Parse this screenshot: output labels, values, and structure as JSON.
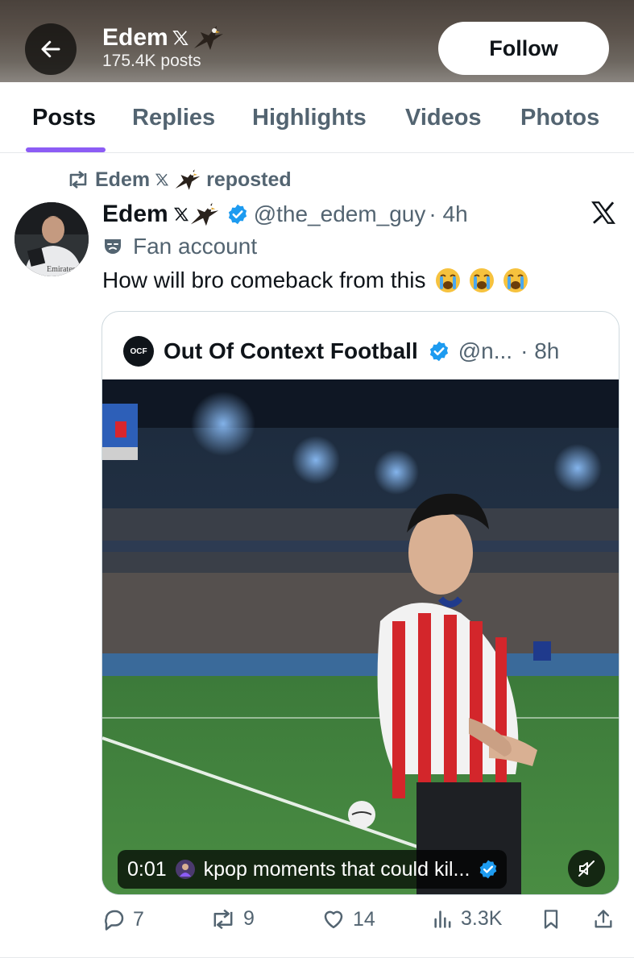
{
  "header": {
    "name": "Edem",
    "posts_count": "175.4K posts",
    "follow_label": "Follow"
  },
  "tabs": [
    {
      "label": "Posts",
      "active": true
    },
    {
      "label": "Replies",
      "active": false
    },
    {
      "label": "Highlights",
      "active": false
    },
    {
      "label": "Videos",
      "active": false
    },
    {
      "label": "Photos",
      "active": false
    }
  ],
  "post": {
    "repost_by": "Edem",
    "repost_suffix": "reposted",
    "author_name": "Edem",
    "author_handle": "@the_edem_guy",
    "time": "· 4h",
    "fan_label": "Fan account",
    "text": "How will bro comeback from this",
    "emojis": [
      "loudly-crying-face",
      "loudly-crying-face",
      "loudly-crying-face"
    ],
    "quote": {
      "logo_text": "OCF",
      "name": "Out Of Context Football",
      "handle": "@n...",
      "time": "· 8h",
      "video_time": "0:01",
      "video_caption": "kpop moments that could kil..."
    },
    "stats": {
      "replies": "7",
      "reposts": "9",
      "likes": "14",
      "views": "3.3K"
    }
  },
  "colors": {
    "accent": "#8c5cf5",
    "verified": "#1d9bf0",
    "muted_text": "#536471",
    "primary_text": "#0f1419"
  },
  "icons": [
    "back-arrow-icon",
    "x-logo-icon",
    "eagle-emoji-icon",
    "repost-icon",
    "verified-badge-icon",
    "theater-mask-icon",
    "reply-icon",
    "like-icon",
    "views-icon",
    "bookmark-icon",
    "share-icon",
    "mute-icon"
  ]
}
